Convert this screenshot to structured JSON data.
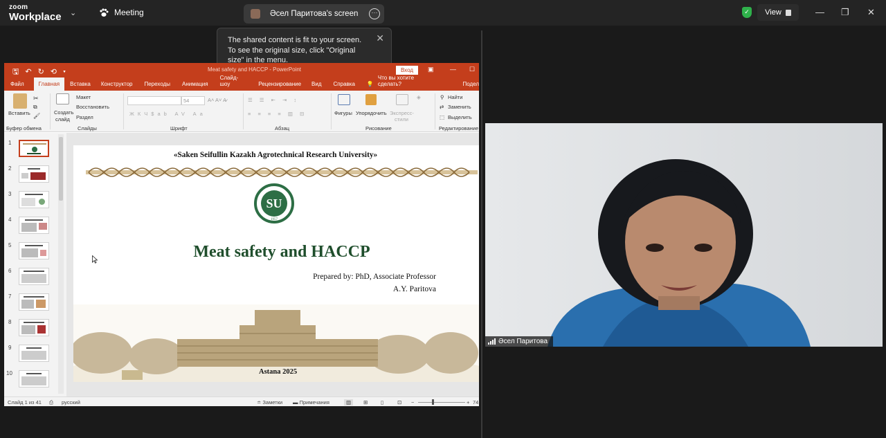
{
  "zoom": {
    "logo_top": "zoom",
    "logo_bottom": "Workplace",
    "meeting_label": "Meeting",
    "share_title": "Әсел Паритова's screen",
    "tooltip_text": "The shared content is fit to your screen. To see the original size, click \"Original size\" in the menu.",
    "view_label": "View",
    "participant_name": "Әсел Паритова"
  },
  "ppt": {
    "window_title": "Meat safety and HACCP - PowerPoint",
    "signin_label": "Вход",
    "tabs": [
      "Файл",
      "Главная",
      "Вставка",
      "Конструктор",
      "Переходы",
      "Анимация",
      "Слайд-шоу",
      "Рецензирование",
      "Вид",
      "Справка"
    ],
    "active_tab": "Главная",
    "tell_me": "Что вы хотите сделать?",
    "share": "Подел",
    "ribbon": {
      "paste": "Вставить",
      "clipboard_group": "Буфер обмена",
      "new_slide_1": "Создать",
      "new_slide_2": "слайд",
      "layout": "Макет",
      "reset": "Восстановить",
      "section": "Раздел",
      "slides_group": "Слайды",
      "font_size": "54",
      "font_group": "Шрифт",
      "paragraph_group": "Абзац",
      "shapes": "Фигуры",
      "arrange": "Упорядочить",
      "quick_styles_1": "Экспресс-",
      "quick_styles_2": "стили",
      "drawing_group": "Рисование",
      "find": "Найти",
      "replace": "Заменить",
      "select": "Выделить",
      "editing_group": "Редактирование"
    },
    "thumbnail_numbers": [
      "1",
      "2",
      "3",
      "4",
      "5",
      "6",
      "7",
      "8",
      "9",
      "10"
    ],
    "slide": {
      "university": "«Saken Seifullin Kazakh Agrotechnical Research University»",
      "title": "Meat safety and HACCP",
      "prepared_by": "Prepared by: PhD, Associate Professor",
      "author": "A.Y. Paritova",
      "footer": "Astana 2025",
      "emblem_year": "1957"
    },
    "status": {
      "slide_counter": "Слайд 1 из 41",
      "language": "русский",
      "notes": "Заметки",
      "comments": "Примечания",
      "zoom": "74"
    }
  },
  "colors": {
    "ppt_accent": "#c43e1c",
    "slide_title": "#1f4e2c",
    "shield": "#2fb14b"
  }
}
